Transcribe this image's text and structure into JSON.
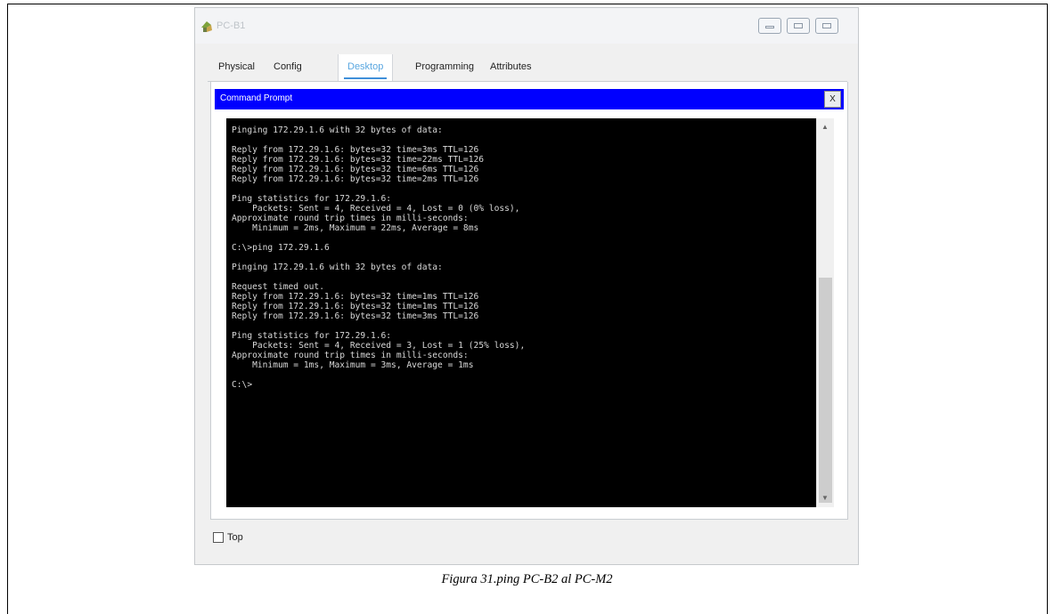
{
  "window": {
    "title": "PC-B1",
    "icon": "pc-device-icon",
    "controls": [
      "minimize-icon",
      "maximize-icon",
      "restore-icon"
    ]
  },
  "tabs": [
    {
      "label": "Physical"
    },
    {
      "label": "Config"
    },
    {
      "label": "Desktop",
      "active": true
    },
    {
      "label": "Programming"
    },
    {
      "label": "Attributes"
    }
  ],
  "command_prompt": {
    "title": "Command Prompt",
    "close_label": "X",
    "lines": [
      "Pinging 172.29.1.6 with 32 bytes of data:",
      "",
      "Reply from 172.29.1.6: bytes=32 time=3ms TTL=126",
      "Reply from 172.29.1.6: bytes=32 time=22ms TTL=126",
      "Reply from 172.29.1.6: bytes=32 time=6ms TTL=126",
      "Reply from 172.29.1.6: bytes=32 time=2ms TTL=126",
      "",
      "Ping statistics for 172.29.1.6:",
      "    Packets: Sent = 4, Received = 4, Lost = 0 (0% loss),",
      "Approximate round trip times in milli-seconds:",
      "    Minimum = 2ms, Maximum = 22ms, Average = 8ms",
      "",
      "C:\\>ping 172.29.1.6",
      "",
      "Pinging 172.29.1.6 with 32 bytes of data:",
      "",
      "Request timed out.",
      "Reply from 172.29.1.6: bytes=32 time=1ms TTL=126",
      "Reply from 172.29.1.6: bytes=32 time=1ms TTL=126",
      "Reply from 172.29.1.6: bytes=32 time=3ms TTL=126",
      "",
      "Ping statistics for 172.29.1.6:",
      "    Packets: Sent = 4, Received = 3, Lost = 1 (25% loss),",
      "Approximate round trip times in milli-seconds:",
      "    Minimum = 1ms, Maximum = 3ms, Average = 1ms",
      "",
      "C:\\>"
    ]
  },
  "top_checkbox": {
    "label": "Top",
    "checked": false
  },
  "caption": "Figura 31.ping PC-B2 al PC-M2",
  "colors": {
    "cmd_header": "#0000ff",
    "terminal_bg": "#000000",
    "terminal_text": "#d9d9d9",
    "active_tab": "#5aa7e0"
  }
}
